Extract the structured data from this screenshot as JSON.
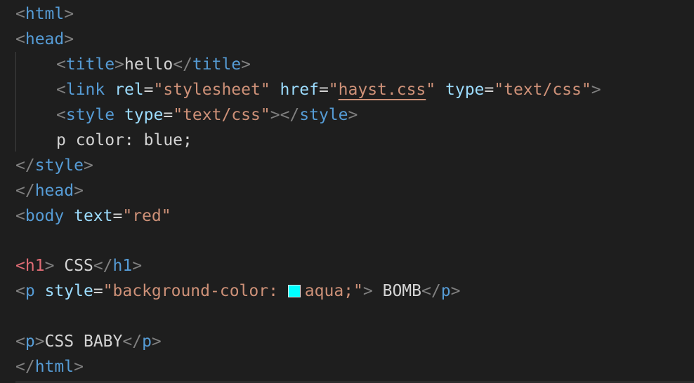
{
  "editor": {
    "lines": {
      "l1": {
        "tag": "html"
      },
      "l2": {
        "tag": "head"
      },
      "l3": {
        "tag": "title",
        "text": "hello"
      },
      "l4": {
        "tag": "link",
        "attr1": "rel",
        "val1": "\"stylesheet\"",
        "attr2": "href",
        "val2_q1": "\"",
        "val2": "hayst.css",
        "val2_q2": "\"",
        "attr3": "type",
        "val3": "\"text/css\""
      },
      "l5": {
        "tag": "style",
        "attr1": "type",
        "val1": "\"text/css\""
      },
      "l6": {
        "text": "p color: blue;"
      },
      "l7": {
        "tag": "style"
      },
      "l8": {
        "tag": "head"
      },
      "l9": {
        "tag": "body",
        "attr1": "text",
        "val1": "\"red\""
      },
      "l11": {
        "tag": "h1",
        "text": " CSS"
      },
      "l12": {
        "tag": "p",
        "attr1": "style",
        "val1_start": "\"background-color: ",
        "val1_end": "aqua;\"",
        "text": " BOMB"
      },
      "l14": {
        "tag": "p",
        "text": "CSS BABY"
      },
      "l15": {
        "tag": "html"
      }
    },
    "syntax": {
      "open": "<",
      "close": ">",
      "end_open": "</",
      "equals": "="
    },
    "colors": {
      "background": "#1e1e1e",
      "tag": "#569cd6",
      "tag_highlight": "#e06c75",
      "attribute": "#9cdcfe",
      "string": "#ce9178",
      "punctuation": "#808080",
      "text": "#d4d4d4",
      "swatch_aqua": "#00ffff"
    }
  }
}
